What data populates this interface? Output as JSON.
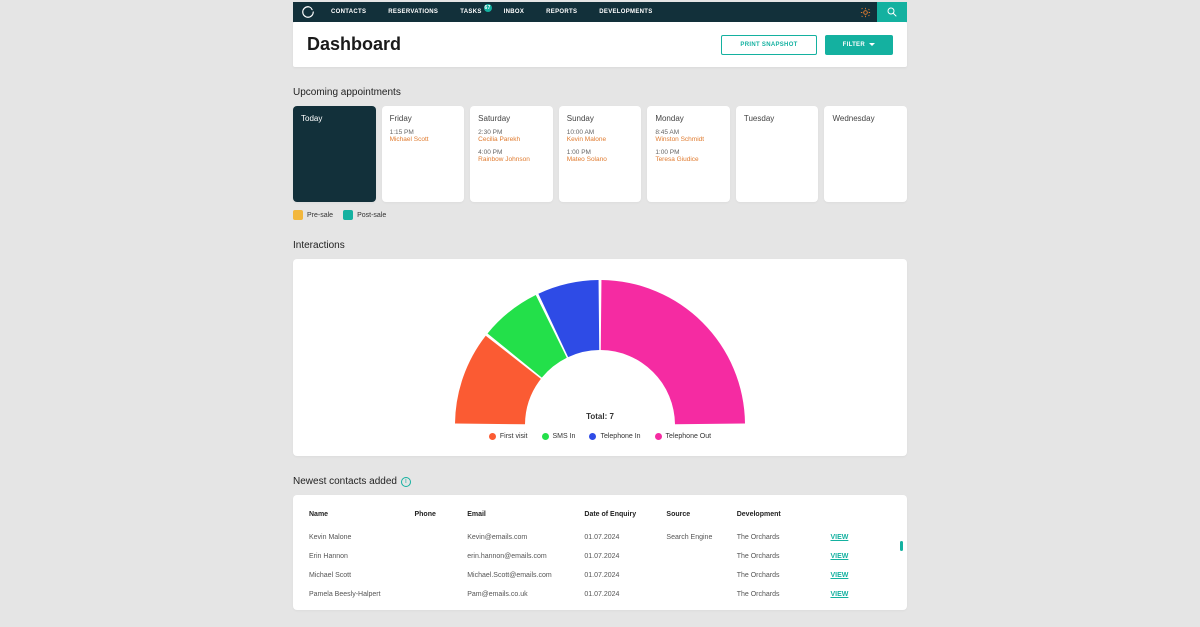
{
  "nav": {
    "items": [
      "CONTACTS",
      "RESERVATIONS",
      "TASKS",
      "INBOX",
      "REPORTS",
      "DEVELOPMENTS"
    ],
    "tasks_badge": "67"
  },
  "header": {
    "title": "Dashboard",
    "print": "PRINT SNAPSHOT",
    "filter": "FILTER"
  },
  "appointments": {
    "title": "Upcoming appointments",
    "legend": {
      "pre": "Pre-sale",
      "post": "Post-sale"
    },
    "colors": {
      "pre": "#f2b73d",
      "post": "#14b1a0"
    },
    "days": [
      {
        "label": "Today",
        "today": true,
        "appts": []
      },
      {
        "label": "Friday",
        "appts": [
          {
            "time": "1:15 PM",
            "name": "Michael Scott"
          }
        ]
      },
      {
        "label": "Saturday",
        "appts": [
          {
            "time": "2:30 PM",
            "name": "Cecilia Parekh"
          },
          {
            "time": "4:00 PM",
            "name": "Rainbow Johnson"
          }
        ]
      },
      {
        "label": "Sunday",
        "appts": [
          {
            "time": "10:00 AM",
            "name": "Kevin Malone"
          },
          {
            "time": "1:00 PM",
            "name": "Mateo Solano"
          }
        ]
      },
      {
        "label": "Monday",
        "appts": [
          {
            "time": "8:45 AM",
            "name": "Winston Schmidt"
          },
          {
            "time": "1:00 PM",
            "name": "Teresa Giudice"
          }
        ]
      },
      {
        "label": "Tuesday",
        "appts": []
      },
      {
        "label": "Wednesday",
        "appts": []
      }
    ]
  },
  "interactions": {
    "title": "Interactions",
    "total_label": "Total:  7"
  },
  "chart_data": {
    "type": "pie",
    "title": "Interactions",
    "series": [
      {
        "name": "First visit",
        "value": 1.5,
        "color": "#fb5b33"
      },
      {
        "name": "SMS In",
        "value": 1,
        "color": "#23e04a"
      },
      {
        "name": "Telephone In",
        "value": 1,
        "color": "#2e4be6"
      },
      {
        "name": "Telephone Out",
        "value": 3.5,
        "color": "#f52ba2"
      }
    ],
    "total": 7,
    "layout": "semi-donut"
  },
  "contacts": {
    "title": "Newest contacts added",
    "columns": [
      "Name",
      "Phone",
      "Email",
      "Date of Enquiry",
      "Source",
      "Development",
      ""
    ],
    "view_label": "VIEW",
    "rows": [
      {
        "name": "Kevin Malone",
        "phone": "",
        "email": "Kevin@emails.com",
        "date": "01.07.2024",
        "source": "Search Engine",
        "dev": "The Orchards"
      },
      {
        "name": "Erin Hannon",
        "phone": "",
        "email": "erin.hannon@emails.com",
        "date": "01.07.2024",
        "source": "",
        "dev": "The Orchards"
      },
      {
        "name": "Michael Scott",
        "phone": "",
        "email": "Michael.Scott@emails.com",
        "date": "01.07.2024",
        "source": "",
        "dev": "The Orchards"
      },
      {
        "name": "Pamela Beesly-Halpert",
        "phone": "",
        "email": "Pam@emails.co.uk",
        "date": "01.07.2024",
        "source": "",
        "dev": "The Orchards"
      }
    ]
  }
}
